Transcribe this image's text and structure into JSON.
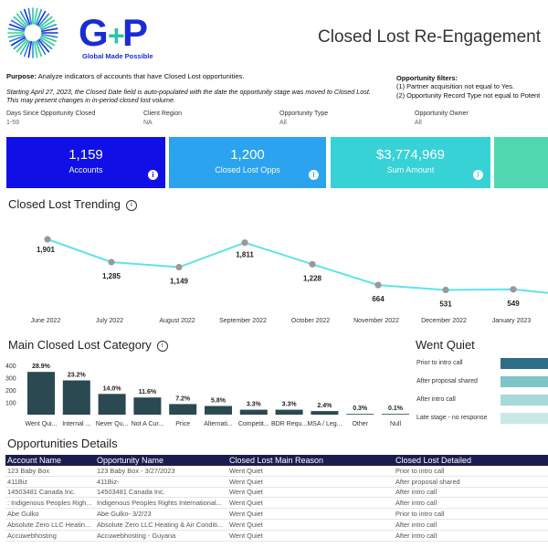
{
  "header": {
    "logo_text": "Global Made Possible",
    "title": "Closed Lost Re-Engagement",
    "purpose_label": "Purpose:",
    "purpose_text": " Analyze indicators of accounts that have Closed Lost opportunities.",
    "note": "Starting April 27, 2023, the Closed Date field is auto-populated with the date the opportunity stage was moved to Closed Lost. This may present changes in in-period closed lost volume.",
    "opp_filters_title": "Opportunity filters:",
    "opp_filter_1": "(1) Partner acquisition not equal to Yes.",
    "opp_filter_2": "(2) Opportunity Record Type not equal to Potent"
  },
  "filters": [
    {
      "label": "Days Since Opportunity Closed",
      "value": "1-59"
    },
    {
      "label": "Client Region",
      "value": "NA"
    },
    {
      "label": "Opportunity Type",
      "value": "All"
    },
    {
      "label": "Opportunity Owner",
      "value": "All"
    }
  ],
  "kpis": [
    {
      "value": "1,159",
      "label": "Accounts",
      "color": "#1010e6"
    },
    {
      "value": "1,200",
      "label": "Closed Lost Opps",
      "color": "#2ba3ef"
    },
    {
      "value": "$3,774,969",
      "label": "Sum Amount",
      "color": "#36d2d6"
    },
    {
      "value": "",
      "label": "",
      "color": "#4fd8b0"
    }
  ],
  "trending": {
    "title": "Closed Lost Trending",
    "info": "ⓘ"
  },
  "main_category": {
    "title": "Main Closed Lost Category",
    "info": "ⓘ"
  },
  "went_quiet": {
    "title": "Went Quiet",
    "rows": [
      {
        "label": "Prior to intro call",
        "color": "#2d6d86"
      },
      {
        "label": "After proposal shared",
        "color": "#7fc4c6"
      },
      {
        "label": "After intro call",
        "color": "#a7d9d8"
      },
      {
        "label": "Late stage - no response",
        "color": "#c7e8e3"
      }
    ]
  },
  "chart_data": [
    {
      "type": "line",
      "title": "Closed Lost Trending",
      "x": [
        "June 2022",
        "July 2022",
        "August 2022",
        "September 2022",
        "October 2022",
        "November 2022",
        "December 2022",
        "January 2023"
      ],
      "values": [
        1901,
        1285,
        1149,
        1811,
        1228,
        664,
        531,
        549
      ],
      "labels": [
        "1,901",
        "1,285",
        "1,149",
        "1,811",
        "1,228",
        "664",
        "531",
        "549"
      ],
      "line_color": "#5ee3ea",
      "point_color": "#999999",
      "ylim": [
        0,
        2000
      ]
    },
    {
      "type": "bar",
      "title": "Main Closed Lost Category",
      "categories": [
        "Went Qui...",
        "Internal ...",
        "Never Qu...",
        "Not A Cur...",
        "Price",
        "Alternati...",
        "Competit...",
        "BDR Requ...",
        "MSA / Leg...",
        "Other",
        "Null"
      ],
      "values": [
        347,
        278,
        168,
        139,
        86,
        70,
        40,
        40,
        29,
        4,
        1
      ],
      "percent_labels": [
        "28.9%",
        "23.2%",
        "14.0%",
        "11.6%",
        "7.2%",
        "5.8%",
        "3.3%",
        "3.3%",
        "2.4%",
        "0.3%",
        "0.1%"
      ],
      "yticks": [
        "400",
        "300",
        "200",
        "100"
      ],
      "ylim": [
        0,
        400
      ],
      "bar_color": "#2a4950"
    }
  ],
  "table": {
    "title": "Opportunities Details",
    "columns": [
      "Account Name",
      "Opportunity Name",
      "Closed Lost Main Reason",
      "Closed  Lost Detailed"
    ],
    "rows": [
      [
        "123 Baby Box",
        "123 Baby Box - 3/27/2023",
        "Went Quiet",
        "Prior to intro call"
      ],
      [
        "411Biz",
        "411Biz-",
        "Went Quiet",
        "After proposal shared"
      ],
      [
        "14503481 Canada Inc.",
        "14503481 Canada Inc.",
        "Went Quiet",
        "After intro call"
      ],
      [
        ": Indigenous Peoples Righ...",
        "Indigenous Peoples Rights International...",
        "Went Quiet",
        "After intro call"
      ],
      [
        "Abe Gulko",
        "Abe Gulko- 3/2/23",
        "Went Quiet",
        "Prior to intro call"
      ],
      [
        "Absolute Zero LLC Heatin...",
        "Absolute Zero LLC Heating & Air Conditi...",
        "Went Quiet",
        "After intro call"
      ],
      [
        "Accuwebhosting",
        "Accuwebhosting - Guyana",
        "Went Quiet",
        "After intro call"
      ]
    ]
  }
}
